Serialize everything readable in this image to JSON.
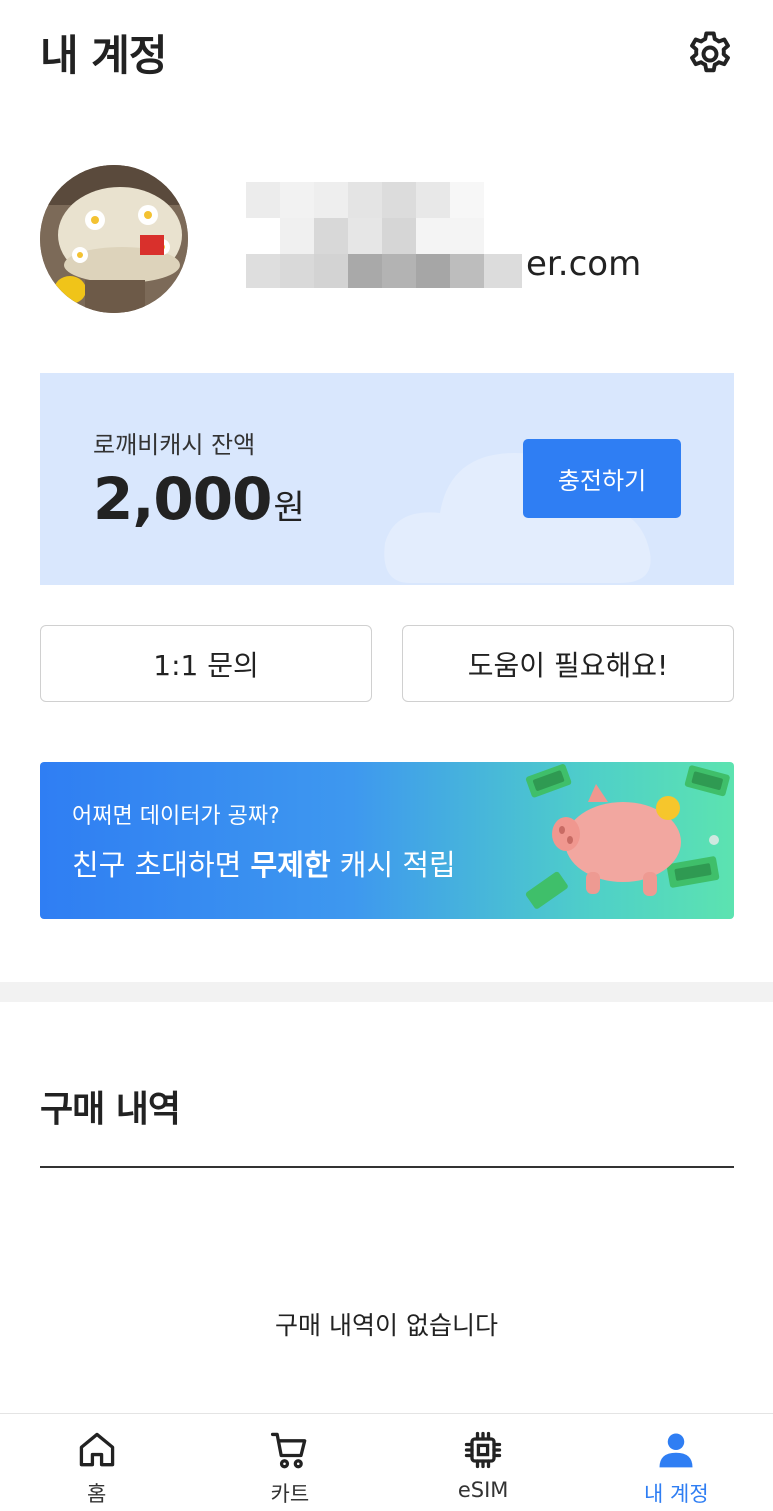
{
  "header": {
    "title": "내 계정",
    "settings_icon": "gear-icon"
  },
  "profile": {
    "avatar_icon": "avatar",
    "email_visible_suffix": "er.com"
  },
  "cash": {
    "label": "로깨비캐시 잔액",
    "amount": "2,000",
    "unit": "원",
    "charge_label": "충전하기",
    "accent_color": "#2f7ef3"
  },
  "actions": {
    "inquiry_label": "1:1 문의",
    "help_label": "도움이 필요해요!"
  },
  "promo": {
    "small_text": "어쩌면 데이터가 공짜?",
    "big_text_prefix": "친구 초대하면 ",
    "big_text_bold": "무제한",
    "big_text_suffix": " 캐시 적립"
  },
  "purchase": {
    "title": "구매 내역",
    "empty_message": "구매 내역이 없습니다"
  },
  "nav": {
    "items": [
      {
        "label": "홈",
        "icon": "home-icon"
      },
      {
        "label": "카트",
        "icon": "cart-icon"
      },
      {
        "label": "eSIM",
        "icon": "chip-icon"
      },
      {
        "label": "내 계정",
        "icon": "user-icon",
        "active": true
      }
    ]
  }
}
